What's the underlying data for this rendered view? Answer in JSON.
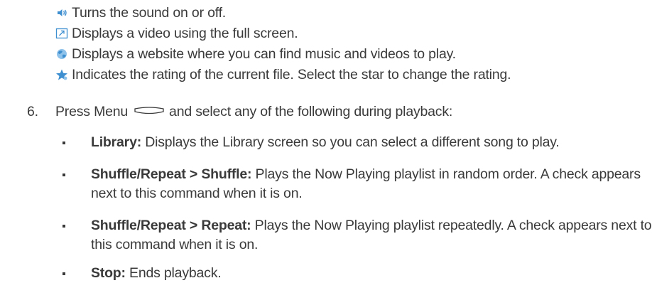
{
  "icon_lines": [
    {
      "icon": "speaker-icon",
      "text": "Turns the sound on or off."
    },
    {
      "icon": "fullscreen-icon",
      "text": "Displays a video using the full screen."
    },
    {
      "icon": "globe-icon",
      "text": "Displays a website where you can find music and videos to play."
    },
    {
      "icon": "star-icon",
      "text": "Indicates the rating of the current file. Select the star to change the rating."
    }
  ],
  "step": {
    "number": "6.",
    "before": "Press Menu",
    "menu_key_icon": "menu-softkey-icon",
    "after": "and select any of the following during playback:"
  },
  "bullets": [
    {
      "term": "Library:",
      "desc": " Displays the Library screen so you can select a different song to play."
    },
    {
      "term": "Shuffle/Repeat > Shuffle:",
      "desc": " Plays the Now Playing playlist in random order. A check appears next to this command when it is on."
    },
    {
      "term": "Shuffle/Repeat > Repeat:",
      "desc": " Plays the Now Playing playlist repeatedly. A check appears next to this command when it is on."
    },
    {
      "term": "Stop:",
      "desc": " Ends playback."
    }
  ],
  "colors": {
    "text": "#3a3a3a",
    "icon_blue": "#3e8fd0"
  }
}
